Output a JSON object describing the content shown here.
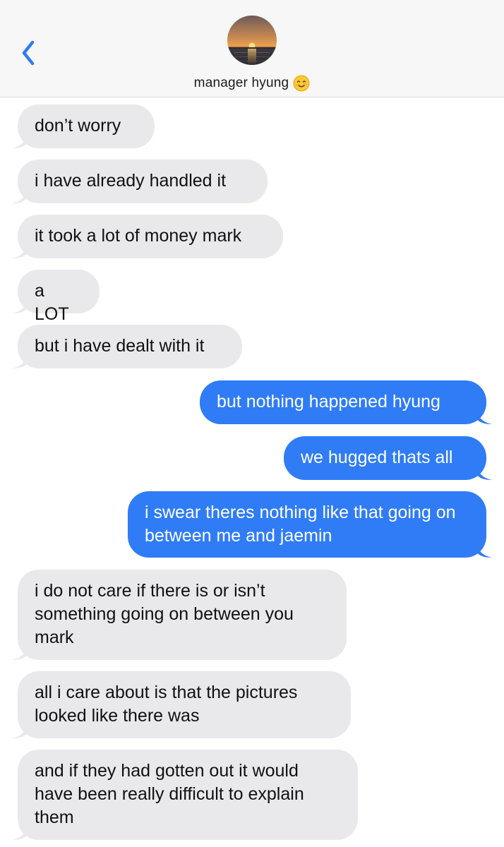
{
  "header": {
    "contact_name": "manager hyung",
    "contact_emoji": "smiling-face-emoji",
    "back_icon": "chevron-left-icon",
    "avatar": "sunset-over-water-avatar"
  },
  "colors": {
    "incoming_bubble": "#e9e9eb",
    "outgoing_bubble": "#2f7cf6",
    "accent": "#2f7cf6",
    "header_bg": "#f7f7f7"
  },
  "messages": [
    {
      "direction": "in",
      "text": "don’t worry"
    },
    {
      "direction": "in",
      "text": "i have already handled it"
    },
    {
      "direction": "in",
      "text": "it took a lot of money mark"
    },
    {
      "direction": "in",
      "text": "a LOT"
    },
    {
      "direction": "in",
      "text": "but i have dealt with it"
    },
    {
      "direction": "out",
      "text": "but nothing happened hyung"
    },
    {
      "direction": "out",
      "text": "we hugged thats all"
    },
    {
      "direction": "out",
      "text": "i swear theres nothing like that going on between me and jaemin"
    },
    {
      "direction": "in",
      "text": "i do not care if there is or isn’t something going on between you mark"
    },
    {
      "direction": "in",
      "text": "all i care about is that the pictures looked like there was"
    },
    {
      "direction": "in",
      "text": "and if they had gotten out it would have been really difficult to explain them"
    }
  ]
}
